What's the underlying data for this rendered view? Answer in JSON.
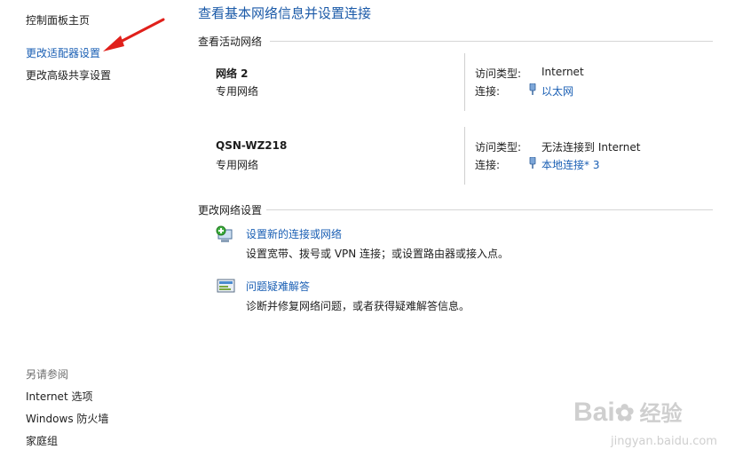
{
  "sidebar": {
    "home": "控制面板主页",
    "items": [
      {
        "label": "更改适配器设置"
      },
      {
        "label": "更改高级共享设置"
      }
    ],
    "see_also_title": "另请参阅",
    "see_also": [
      {
        "label": "Internet 选项"
      },
      {
        "label": "Windows 防火墙"
      },
      {
        "label": "家庭组"
      }
    ]
  },
  "main": {
    "title": "查看基本网络信息并设置连接",
    "active_networks_title": "查看活动网络",
    "networks": [
      {
        "name": "网络  2",
        "category": "专用网络",
        "access_label": "访问类型:",
        "access_value": "Internet",
        "conn_label": "连接:",
        "conn_value": "以太网"
      },
      {
        "name": "QSN-WZ218",
        "category": "专用网络",
        "access_label": "访问类型:",
        "access_value": "无法连接到 Internet",
        "conn_label": "连接:",
        "conn_value": "本地连接* 3"
      }
    ],
    "change_settings_title": "更改网络设置",
    "tasks": [
      {
        "link": "设置新的连接或网络",
        "desc": "设置宽带、拨号或 VPN 连接；或设置路由器或接入点。",
        "icon": "new-connection-icon"
      },
      {
        "link": "问题疑难解答",
        "desc": "诊断并修复网络问题，或者获得疑难解答信息。",
        "icon": "troubleshoot-icon"
      }
    ]
  },
  "watermark": {
    "brand": "Bai",
    "brand2": "经验",
    "url": "jingyan.baidu.com"
  },
  "colors": {
    "link": "#1a5fb4",
    "title": "#1b5aa8",
    "arrow": "#e0201b"
  }
}
